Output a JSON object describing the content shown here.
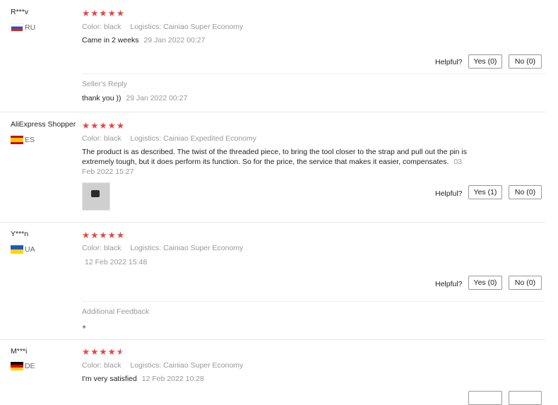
{
  "reviews": [
    {
      "user": "R***v",
      "country": "RU",
      "color_label": "Color:",
      "color": "black",
      "logistics_label": "Logistics:",
      "logistics": "Cainiao Super Economy",
      "text": "Came in 2 weeks",
      "date": "29 Jan 2022 00:27",
      "helpful_label": "Helpful?",
      "yes": "Yes (0)",
      "no": "No (0)",
      "reply_title": "Seller's Reply",
      "reply_text": "thank you ))",
      "reply_date": "29 Jan 2022 00:27",
      "rating": 5
    },
    {
      "user": "AliExpress Shopper",
      "country": "ES",
      "color_label": "Color:",
      "color": "black",
      "logistics_label": "Logistics:",
      "logistics": "Cainiao Expedited Economy",
      "text_line1": "The product is as described. The twist of the threaded piece, to bring the tool closer to the strap and pull out the pin is",
      "text_line2": "extremely tough, but it does perform its function. So for the price, the service that makes it easier, compensates.",
      "date_part1": "03",
      "date_part2": "Feb 2022 15:27",
      "helpful_label": "Helpful?",
      "yes": "Yes (1)",
      "no": "No (0)",
      "rating": 5
    },
    {
      "user": "Y***n",
      "country": "UA",
      "color_label": "Color:",
      "color": "black",
      "logistics_label": "Logistics:",
      "logistics": "Cainiao Super Economy",
      "date": "12 Feb 2022 15:48",
      "helpful_label": "Helpful?",
      "yes": "Yes (0)",
      "no": "No (0)",
      "additional_title": "Additional Feedback",
      "additional_text": "+",
      "rating": 5
    },
    {
      "user": "M***i",
      "country": "DE",
      "color_label": "Color:",
      "color": "black",
      "logistics_label": "Logistics:",
      "logistics": "Cainiao Super Economy",
      "text": "I'm very satisfied",
      "date": "12 Feb 2022 10:28",
      "rating": 4.5
    }
  ],
  "star_glyph": "★★★★★",
  "star_glyph_4": "★★★★",
  "star_glyph_half": "★",
  "colors": {
    "star": "#e64545",
    "muted": "#999999",
    "border": "#e8e8e8"
  }
}
